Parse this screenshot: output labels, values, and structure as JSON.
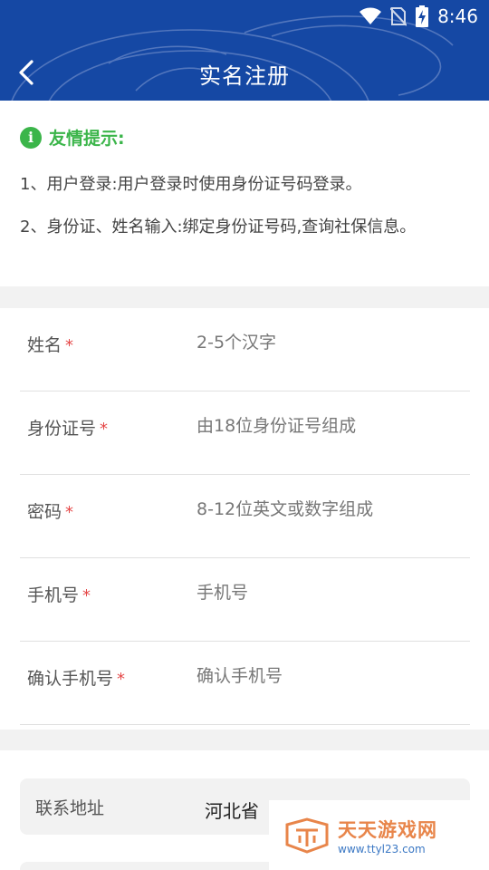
{
  "status_bar": {
    "time": "8:46",
    "icons": [
      "wifi-icon",
      "no-sim-icon",
      "battery-charging-icon"
    ]
  },
  "header": {
    "title": "实名注册",
    "back_icon": "back-arrow-icon"
  },
  "tips": {
    "title": "友情提示:",
    "icon": "info-icon",
    "icon_glyph": "i",
    "line1": "1、用户登录:用户登录时使用身份证号码登录。",
    "line2": "2、身份证、姓名输入:绑定身份证号码,查询社保信息。"
  },
  "form": {
    "required_mark": "*",
    "fields": [
      {
        "label": "姓名",
        "placeholder": "2-5个汉字"
      },
      {
        "label": "身份证号",
        "placeholder": "由18位身份证号组成"
      },
      {
        "label": "密码",
        "placeholder": "8-12位英文或数字组成"
      },
      {
        "label": "手机号",
        "placeholder": "手机号"
      },
      {
        "label": "确认手机号",
        "placeholder": "确认手机号"
      }
    ]
  },
  "address": {
    "label": "联系地址",
    "value": "河北省"
  },
  "watermark": {
    "name": "天天游戏网",
    "url": "www.ttyl23.com"
  },
  "colors": {
    "header_bg": "#1548a4",
    "tip_green": "#3bb54a",
    "required_red": "#e54848",
    "page_bg": "#f2f2f2"
  }
}
